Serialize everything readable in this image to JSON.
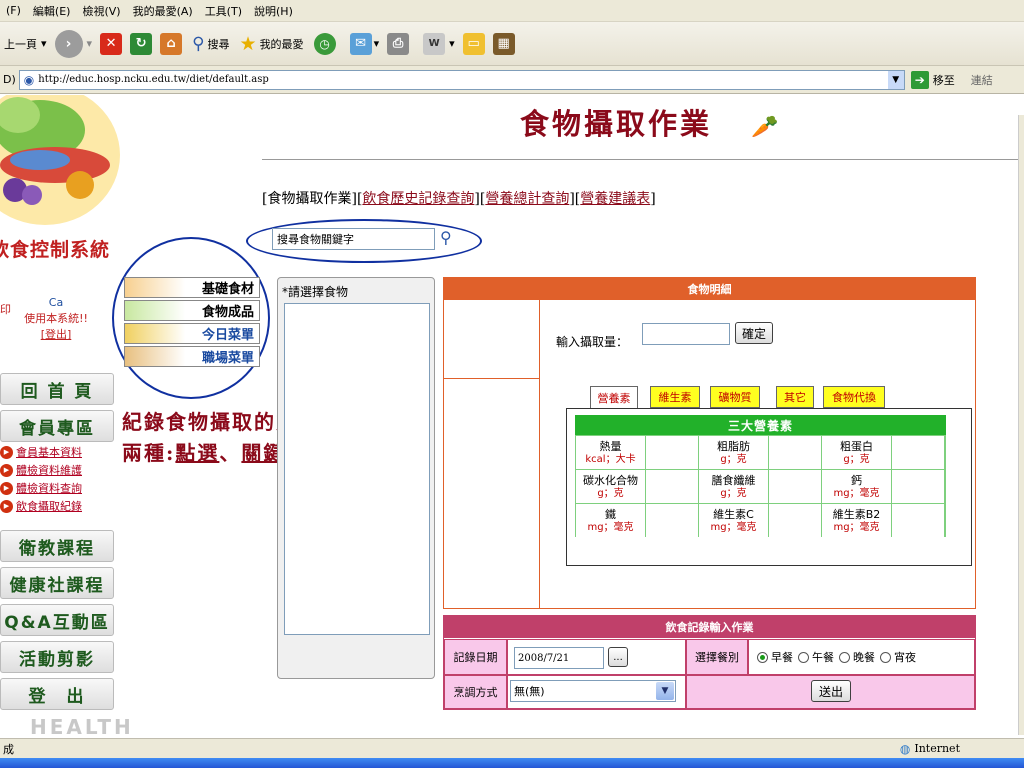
{
  "menu": [
    "(F)",
    "編輯(E)",
    "檢視(V)",
    "我的最愛(A)",
    "工具(T)",
    "說明(H)"
  ],
  "toolbar": {
    "back_label": "上一頁",
    "search_label": "搜尋",
    "favorites_label": "我的最愛"
  },
  "address": {
    "prefix": "D)",
    "url": "http://educ.hosp.ncku.edu.tw/diet/default.asp",
    "go_label": "移至",
    "links_label": "連結"
  },
  "sidebar": {
    "system_title": "飲食控制系統",
    "welcome_text": "使用本系統!!",
    "welcome_mark": "Ca",
    "left_mark": "印",
    "logout_link": "[登出]",
    "nav": [
      "回 首 頁",
      "會員專區",
      "衛教課程",
      "健康社課程",
      "Q&A互動區",
      "活動剪影",
      "登　出"
    ],
    "subnav": [
      "會員基本資料",
      "體檢資料維護",
      "體檢資料查詢",
      "飲食攝取紀錄"
    ],
    "health_text": "HEALTH"
  },
  "categories": [
    "基礎食材",
    "食物成品",
    "今日菜單",
    "職場菜單"
  ],
  "main": {
    "title": "食物攝取作業",
    "tabs": {
      "current": "[食物攝取作業]",
      "links": [
        "飲食歷史記錄查詢",
        "營養總計查詢",
        "營養建議表"
      ]
    },
    "search_placeholder": "搜尋食物關鍵字",
    "select_label": "*請選擇食物"
  },
  "annotation": {
    "line1": "紀錄食物攝取的方式有",
    "line2_prefix": "兩種:",
    "point": "點選",
    "sep": "、",
    "keyword": "關鍵字查詢"
  },
  "detail": {
    "header": "食物明細",
    "amount_label": "輸入攝取量：",
    "confirm_button": "確定",
    "nutrient_tabs": [
      "營養素",
      "維生素",
      "礦物質",
      "其它",
      "食物代換"
    ],
    "table_title": "三大營養素",
    "cells": [
      {
        "name": "熱量",
        "unit": "kcal；大卡"
      },
      {
        "name": "粗脂肪",
        "unit": "g；克"
      },
      {
        "name": "粗蛋白",
        "unit": "g；克"
      },
      {
        "name": "碳水化合物",
        "unit": "g；克"
      },
      {
        "name": "膳食纖維",
        "unit": "g；克"
      },
      {
        "name": "鈣",
        "unit": "mg；毫克"
      },
      {
        "name": "鐵",
        "unit": "mg；毫克"
      },
      {
        "name": "維生素C",
        "unit": "mg；毫克"
      },
      {
        "name": "維生素B2",
        "unit": "mg；毫克"
      }
    ]
  },
  "record": {
    "header": "飲食記錄輸入作業",
    "date_label": "記錄日期",
    "date_value": "2008/7/21",
    "date_picker_label": "...",
    "meal_label": "選擇餐別",
    "meals": [
      "早餐",
      "午餐",
      "晚餐",
      "宵夜"
    ],
    "cook_label": "烹調方式",
    "cook_value": "無(無)",
    "submit_button": "送出"
  },
  "status": {
    "left": "成",
    "zone": "Internet"
  }
}
